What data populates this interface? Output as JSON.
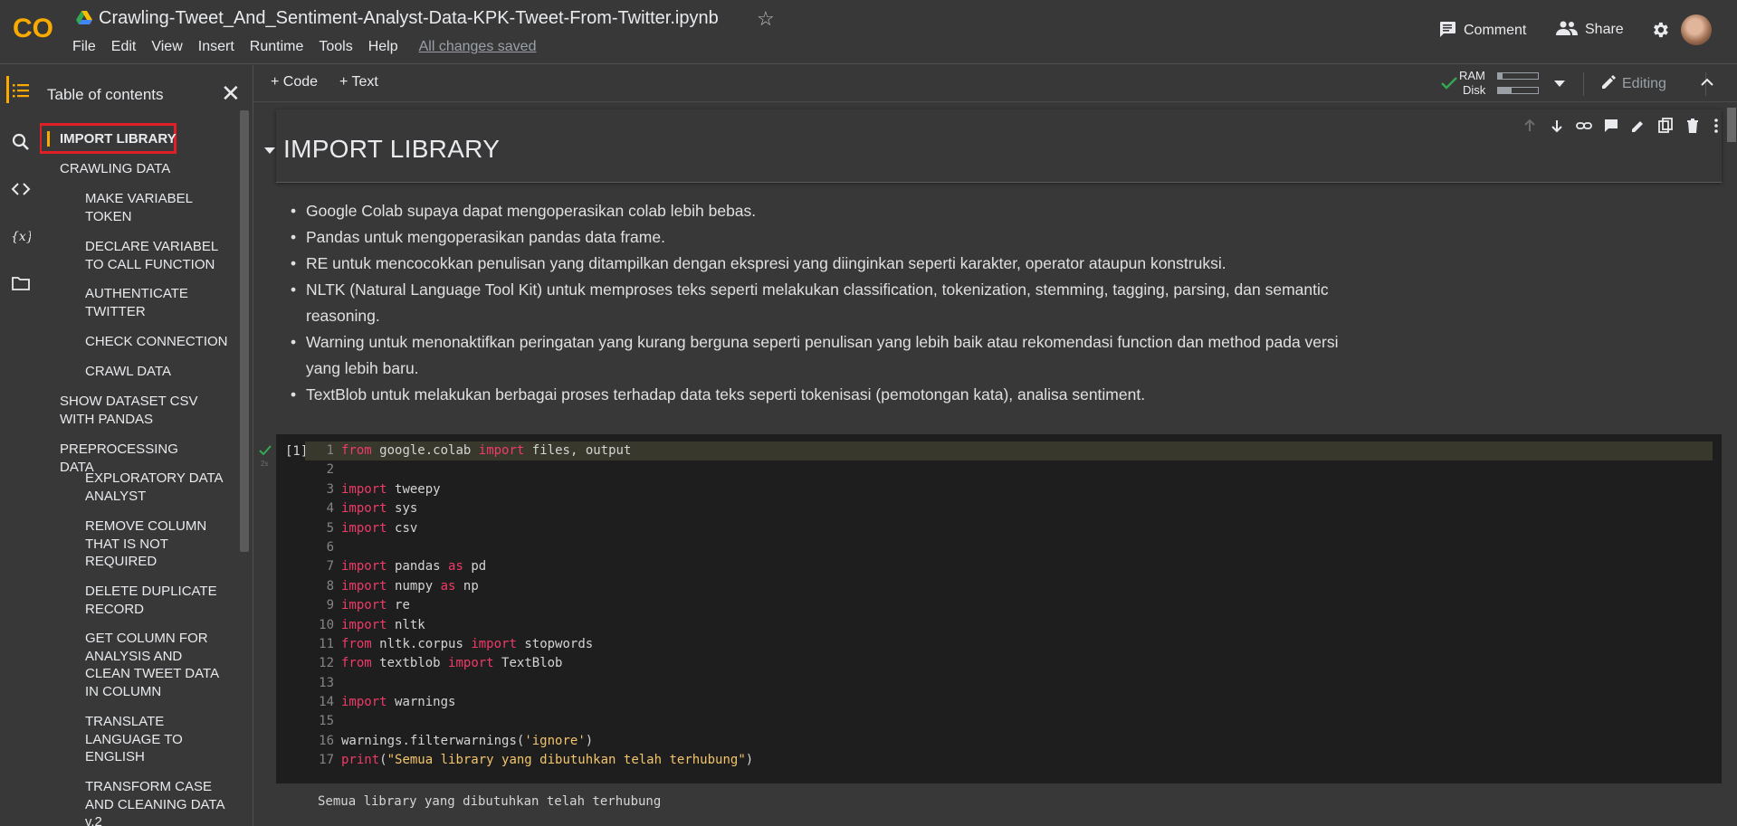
{
  "header": {
    "notebook_title": "Crawling-Tweet_And_Sentiment-Analyst-Data-KPK-Tweet-From-Twitter.ipynb",
    "menu": [
      "File",
      "Edit",
      "View",
      "Insert",
      "Runtime",
      "Tools",
      "Help"
    ],
    "saved_status": "All changes saved",
    "comment_label": "Comment",
    "share_label": "Share",
    "logo_text": "CO"
  },
  "toolbar": {
    "code_label": "+ Code",
    "text_label": "+ Text",
    "ram_label": "RAM",
    "disk_label": "Disk",
    "ram_usage": 0.12,
    "disk_usage": 0.35,
    "editing_label": "Editing"
  },
  "toc": {
    "title": "Table of contents",
    "items": [
      {
        "label": "IMPORT LIBRARY",
        "level": 1,
        "active": true
      },
      {
        "label": "CRAWLING DATA",
        "level": 1
      },
      {
        "label": "MAKE VARIABEL TOKEN",
        "level": 2
      },
      {
        "label": "DECLARE VARIABEL TO CALL FUNCTION",
        "level": 2
      },
      {
        "label": "AUTHENTICATE TWITTER",
        "level": 2
      },
      {
        "label": "CHECK CONNECTION",
        "level": 2
      },
      {
        "label": "CRAWL DATA",
        "level": 2
      },
      {
        "label": "SHOW DATASET CSV WITH PANDAS",
        "level": 1
      },
      {
        "label": "PREPROCESSING DATA",
        "level": 1
      },
      {
        "label": "EXPLORATORY DATA ANALYST",
        "level": 2
      },
      {
        "label": "REMOVE COLUMN THAT IS NOT REQUIRED",
        "level": 2
      },
      {
        "label": "DELETE DUPLICATE RECORD",
        "level": 2
      },
      {
        "label": "GET COLUMN FOR ANALYSIS AND CLEAN TWEET DATA IN COLUMN",
        "level": 2
      },
      {
        "label": "TRANSLATE LANGUAGE TO ENGLISH",
        "level": 2
      },
      {
        "label": "TRANSFORM CASE AND CLEANING DATA v.2",
        "level": 2
      }
    ]
  },
  "notebook": {
    "heading": "IMPORT LIBRARY",
    "bullets": [
      "Google Colab supaya dapat mengoperasikan colab lebih bebas.",
      "Pandas untuk mengoperasikan pandas data frame.",
      "RE untuk mencocokkan penulisan yang ditampilkan dengan ekspresi yang diinginkan seperti karakter, operator ataupun konstruksi.",
      "NLTK (Natural Language Tool Kit) untuk memproses teks seperti melakukan classification, tokenization, stemming, tagging, parsing, dan semantic reasoning.",
      "Warning untuk menonaktifkan peringatan yang kurang berguna seperti penulisan yang lebih baik atau rekomendasi function dan method pada versi yang lebih baru.",
      "TextBlob untuk melakukan berbagai proses terhadap data teks seperti tokenisasi (pemotongan kata), analisa sentiment."
    ],
    "code_cell": {
      "exec_count": "[1]",
      "run_time": "2s",
      "lines": [
        "from google.colab import files, output",
        "",
        "import tweepy",
        "import sys",
        "import csv",
        "",
        "import pandas as pd",
        "import numpy as np",
        "import re",
        "import nltk",
        "from nltk.corpus import stopwords",
        "from textblob import TextBlob",
        "",
        "import warnings",
        "",
        "warnings.filterwarnings('ignore')",
        "print(\"Semua library yang dibutuhkan telah terhubung\")"
      ]
    },
    "output": "Semua library yang dibutuhkan telah terhubung"
  },
  "colors": {
    "background": "#383838",
    "code_background": "#1e1e1e",
    "keyword": "#ee3b68",
    "string": "#f2c46c",
    "accent": "#f9ab00",
    "highlight_box": "#e01f26",
    "check": "#34a853"
  }
}
